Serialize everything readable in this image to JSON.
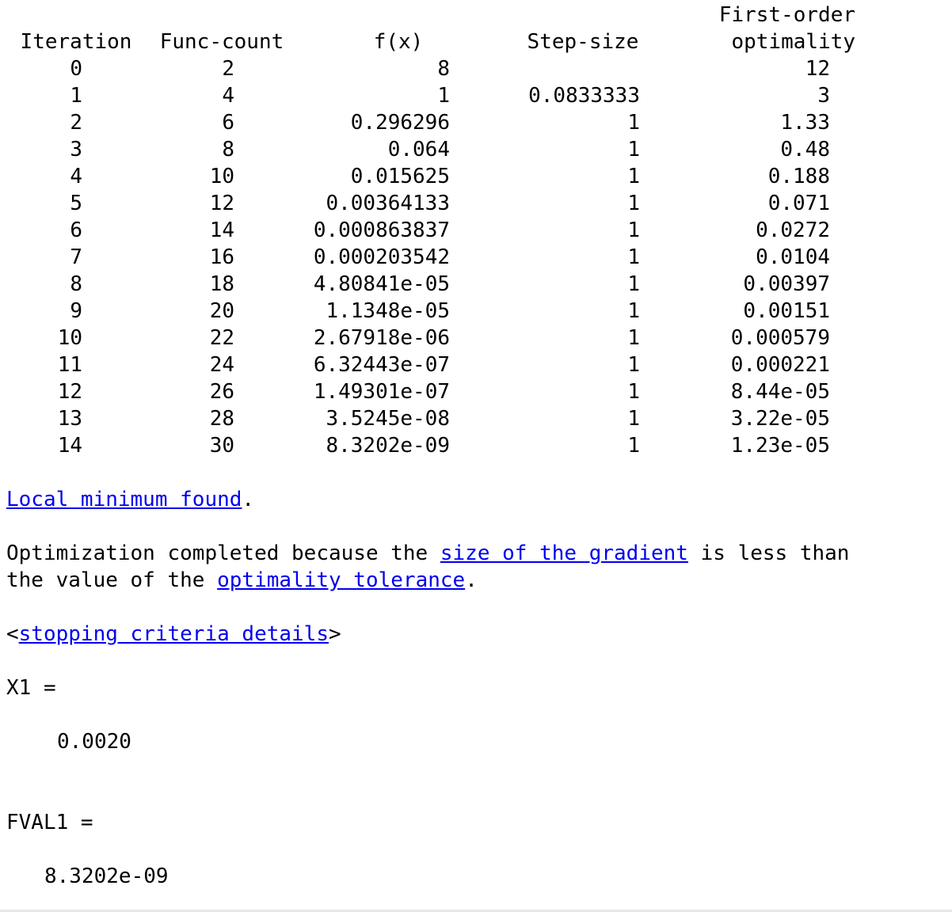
{
  "table": {
    "headers": {
      "iteration": "Iteration",
      "func_count": "Func-count",
      "fx": "f(x)",
      "step_size": "Step-size",
      "first_order_line1": "First-order",
      "first_order_line2": "optimality"
    },
    "rows": [
      {
        "iter": "0",
        "fcount": "2",
        "fx": "8",
        "step": "",
        "opt": "12"
      },
      {
        "iter": "1",
        "fcount": "4",
        "fx": "1",
        "step": "0.0833333",
        "opt": "3"
      },
      {
        "iter": "2",
        "fcount": "6",
        "fx": "0.296296",
        "step": "1",
        "opt": "1.33"
      },
      {
        "iter": "3",
        "fcount": "8",
        "fx": "0.064",
        "step": "1",
        "opt": "0.48"
      },
      {
        "iter": "4",
        "fcount": "10",
        "fx": "0.015625",
        "step": "1",
        "opt": "0.188"
      },
      {
        "iter": "5",
        "fcount": "12",
        "fx": "0.00364133",
        "step": "1",
        "opt": "0.071"
      },
      {
        "iter": "6",
        "fcount": "14",
        "fx": "0.000863837",
        "step": "1",
        "opt": "0.0272"
      },
      {
        "iter": "7",
        "fcount": "16",
        "fx": "0.000203542",
        "step": "1",
        "opt": "0.0104"
      },
      {
        "iter": "8",
        "fcount": "18",
        "fx": "4.80841e-05",
        "step": "1",
        "opt": "0.00397"
      },
      {
        "iter": "9",
        "fcount": "20",
        "fx": "1.1348e-05",
        "step": "1",
        "opt": "0.00151"
      },
      {
        "iter": "10",
        "fcount": "22",
        "fx": "2.67918e-06",
        "step": "1",
        "opt": "0.000579"
      },
      {
        "iter": "11",
        "fcount": "24",
        "fx": "6.32443e-07",
        "step": "1",
        "opt": "0.000221"
      },
      {
        "iter": "12",
        "fcount": "26",
        "fx": "1.49301e-07",
        "step": "1",
        "opt": "8.44e-05"
      },
      {
        "iter": "13",
        "fcount": "28",
        "fx": "3.5245e-08",
        "step": "1",
        "opt": "3.22e-05"
      },
      {
        "iter": "14",
        "fcount": "30",
        "fx": "8.3202e-09",
        "step": "1",
        "opt": "1.23e-05"
      }
    ]
  },
  "messages": {
    "local_min_link": "Local minimum found",
    "local_min_end": ".",
    "opt_line1_prefix": "Optimization completed because the ",
    "opt_line1_link": "size of the gradient",
    "opt_line1_suffix": " is less than",
    "opt_line2_prefix": "the value of the ",
    "opt_line2_link": "optimality tolerance",
    "opt_line2_suffix": ".",
    "criteria_open": "<",
    "criteria_link": "stopping criteria details",
    "criteria_close": ">"
  },
  "outputs": {
    "x1_label": "X1 =",
    "x1_value": "0.0020",
    "fval1_label": "FVAL1 =",
    "fval1_value": "8.3202e-09"
  },
  "colors": {
    "link": "#0000ee",
    "text": "#000000",
    "background": "#ffffff"
  }
}
